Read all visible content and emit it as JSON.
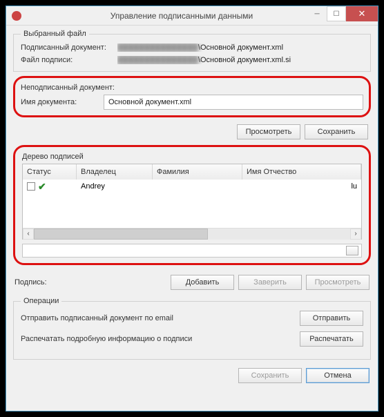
{
  "window": {
    "title": "Управление подписанными данными"
  },
  "selected_file": {
    "legend": "Выбранный файл",
    "signed_doc_label": "Подписанный документ:",
    "signed_doc_blur": "███████████████",
    "signed_doc_tail": "\\Основной документ.xml",
    "sig_file_label": "Файл подписи:",
    "sig_file_blur": "███████████████",
    "sig_file_tail": "\\Основной документ.xml.si"
  },
  "unsigned": {
    "title": "Неподписанный документ:",
    "name_label": "Имя документа:",
    "name_value": "Основной документ.xml"
  },
  "buttons": {
    "view": "Просмотреть",
    "save": "Сохранить"
  },
  "tree": {
    "title": "Дерево подписей",
    "cols": [
      "Статус",
      "Владелец",
      "Фамилия",
      "Имя Отчество"
    ],
    "rows": [
      {
        "owner": "Andrey",
        "surname": "",
        "tail": "lu"
      }
    ]
  },
  "signature": {
    "label": "Подпись:",
    "add": "Добавить",
    "certify": "Заверить",
    "view": "Просмотреть"
  },
  "ops": {
    "legend": "Операции",
    "send_label": "Отправить подписанный документ по email",
    "send_btn": "Отправить",
    "print_label": "Распечатать подробную информацию о подписи",
    "print_btn": "Распечатать"
  },
  "footer": {
    "save": "Сохранить",
    "cancel": "Отмена"
  }
}
